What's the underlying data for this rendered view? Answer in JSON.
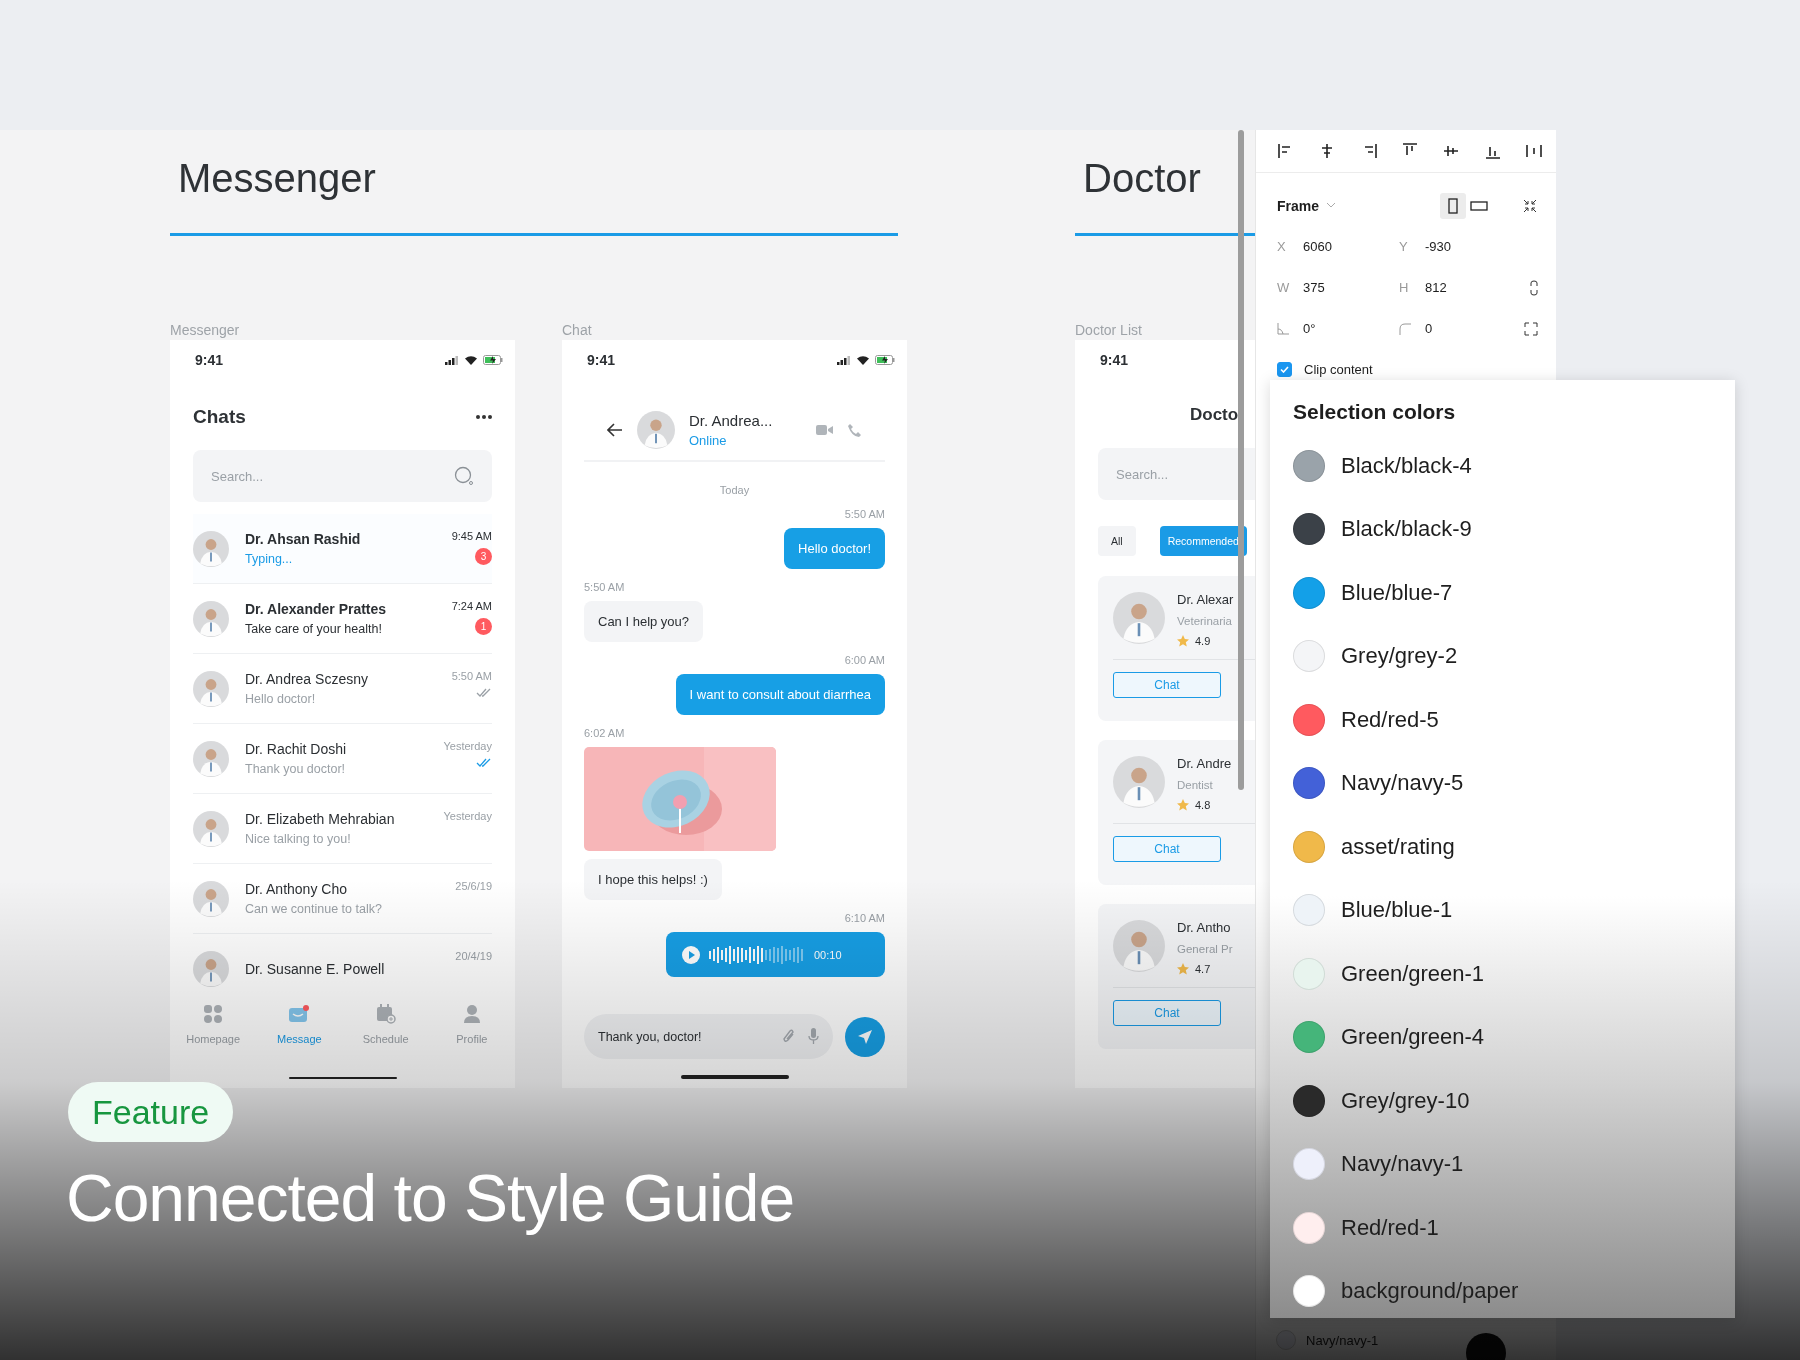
{
  "canvas": {
    "sections": [
      {
        "title": "Messenger"
      },
      {
        "title": "Doctor"
      }
    ],
    "messenger": {
      "label": "Messenger",
      "time": "9:41",
      "title": "Chats",
      "search": {
        "placeholder": "Search..."
      },
      "chats": [
        {
          "name": "Dr. Ahsan Rashid",
          "preview": "Typing...",
          "time": "9:45 AM",
          "badge": "3",
          "typing": true,
          "unread": true,
          "delivered": false
        },
        {
          "name": "Dr. Alexander Prattes",
          "preview": "Take care of your health!",
          "time": "7:24 AM",
          "badge": "1",
          "typing": false,
          "unread": true,
          "delivered": false
        },
        {
          "name": "Dr. Andrea Sczesny",
          "preview": "Hello doctor!",
          "time": "5:50 AM",
          "typing": false,
          "unread": false,
          "delivered": true,
          "read": false
        },
        {
          "name": "Dr. Rachit Doshi",
          "preview": "Thank you doctor!",
          "time": "Yesterday",
          "typing": false,
          "unread": false,
          "delivered": true,
          "read": true
        },
        {
          "name": "Dr. Elizabeth Mehrabian",
          "preview": "Nice talking to you!",
          "time": "Yesterday",
          "typing": false,
          "unread": false,
          "delivered": false
        },
        {
          "name": "Dr. Anthony Cho",
          "preview": "Can we continue to talk?",
          "time": "25/6/19",
          "typing": false,
          "unread": false,
          "delivered": false
        },
        {
          "name": "Dr. Susanne E. Powell",
          "time": "20/4/19",
          "unread": false,
          "delivered": false
        }
      ],
      "nav": [
        {
          "kind": "home",
          "label": "Homepage",
          "selected": false
        },
        {
          "kind": "message",
          "label": "Message",
          "selected": true
        },
        {
          "kind": "schedule",
          "label": "Schedule",
          "selected": false
        },
        {
          "kind": "profile",
          "label": "Profile",
          "selected": false
        }
      ]
    },
    "chat": {
      "label": "Chat",
      "time": "9:41",
      "contact": "Dr. Andrea...",
      "status": "Online",
      "messages": [
        {
          "kind": "date",
          "text": "Today"
        },
        {
          "kind": "sent",
          "time": "5:50 AM",
          "text": "Hello doctor!"
        },
        {
          "kind": "received",
          "time": "5:50 AM",
          "text": "Can I help you?"
        },
        {
          "kind": "sent",
          "time": "6:00 AM",
          "text": "I want to consult about diarrhea"
        },
        {
          "time": "6:02 AM"
        },
        {
          "kind": "received",
          "text": "I hope this helps! :)"
        },
        {
          "kind": "voice",
          "time": "6:10 AM",
          "duration": "00:10",
          "level": 0.55
        }
      ],
      "composer": {
        "value": "Thank you, doctor!"
      }
    },
    "doctor_list": {
      "label": "Doctor List",
      "time": "9:41",
      "title": "Docto",
      "search": {
        "placeholder": "Search..."
      },
      "filters": [
        {
          "label": "All",
          "selected": false
        },
        {
          "label": "Recommended",
          "selected": true
        }
      ],
      "doctors": [
        {
          "name": "Dr. Alexar",
          "specialty": "Veterinaria",
          "rating": "4.9",
          "button": "Chat"
        },
        {
          "name": "Dr. Andre",
          "specialty": "Dentist",
          "rating": "4.8",
          "button": "Chat"
        },
        {
          "name": "Dr. Antho",
          "specialty": "General Pr",
          "rating": "4.7",
          "button": "Chat"
        }
      ]
    }
  },
  "properties": {
    "frame_label": "Frame",
    "orientations": [
      {
        "kind": "portrait",
        "selected": true
      },
      {
        "kind": "landscape",
        "selected": false
      }
    ],
    "fields": [
      {
        "kind": "x",
        "label": "X",
        "value": "6060"
      },
      {
        "kind": "y",
        "label": "Y",
        "value": "-930"
      },
      {
        "kind": "w",
        "label": "W",
        "value": "375"
      },
      {
        "kind": "h",
        "label": "H",
        "value": "812"
      },
      {
        "kind": "rotation",
        "value": "0°"
      },
      {
        "kind": "radius",
        "value": "0"
      }
    ],
    "clip_content": {
      "label": "Clip content",
      "checked": true
    },
    "behind_row": "Navy/navy-1"
  },
  "selection_colors": {
    "title": "Selection colors",
    "colors": [
      {
        "name": "Black/black-4",
        "color": "#9aa3aa"
      },
      {
        "name": "Black/black-9",
        "color": "#3b4148"
      },
      {
        "name": "Blue/blue-7",
        "color": "#13a0e8"
      },
      {
        "name": "Grey/grey-2",
        "color": "#f4f5f7"
      },
      {
        "name": "Red/red-5",
        "color": "#ff5a5f"
      },
      {
        "name": "Navy/navy-5",
        "color": "#4361d8"
      },
      {
        "name": "asset/rating",
        "color": "#f0b94a"
      },
      {
        "name": "Blue/blue-1",
        "color": "#eef3f8"
      },
      {
        "name": "Green/green-1",
        "color": "#e8f4ee"
      },
      {
        "name": "Green/green-4",
        "color": "#45b57a"
      },
      {
        "name": "Grey/grey-10",
        "color": "#2a2a2a"
      },
      {
        "name": "Navy/navy-1",
        "color": "#eef0fb"
      },
      {
        "name": "Red/red-1",
        "color": "#ffeeee"
      },
      {
        "name": "background/paper",
        "color": "#ffffff"
      }
    ]
  },
  "banner": {
    "tag": "Feature",
    "title": "Connected to Style Guide"
  }
}
